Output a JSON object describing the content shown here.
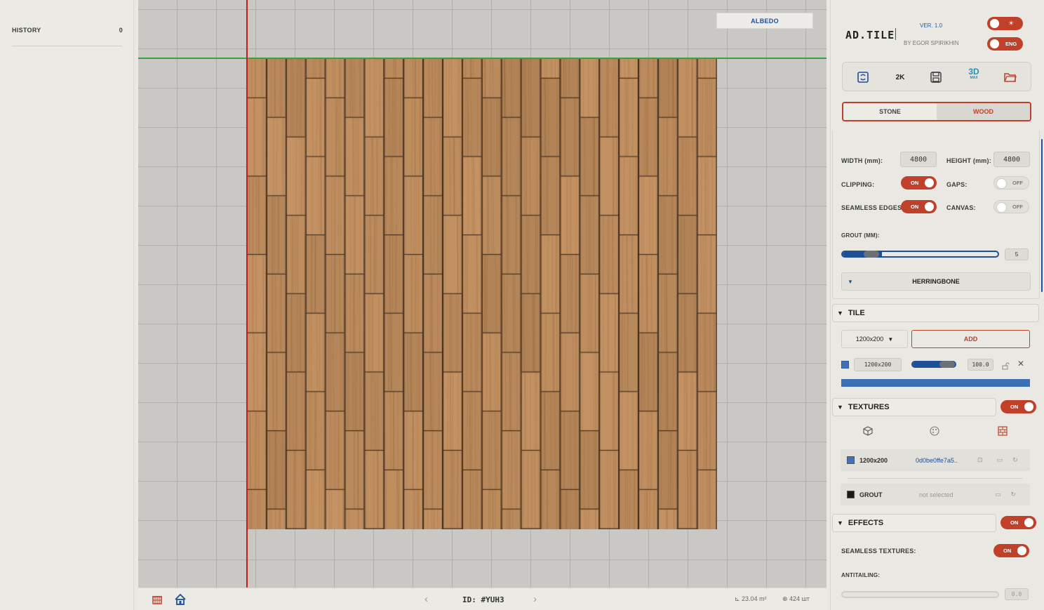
{
  "history": {
    "label": "HISTORY",
    "count": "0"
  },
  "viewport": {
    "channel_badge": "ALBEDO"
  },
  "bottom_bar": {
    "id_label": "ID: #YUH3",
    "area": "23.04 m²",
    "count": "424 шт"
  },
  "app": {
    "title": "AD.TILE",
    "version": "VER. 1.0",
    "author": "BY EGOR SPIRIKHIN",
    "lang": "ENG",
    "theme_icon": "☀"
  },
  "toolbar": {
    "resolution": "2K",
    "three_d": "3D",
    "three_d_sub": "MAX"
  },
  "material_tabs": {
    "stone": "STONE",
    "wood": "WOOD",
    "active": "wood"
  },
  "geometry": {
    "width_label": "WIDTH (mm):",
    "width_value": "4800",
    "height_label": "HEIGHT (mm):",
    "height_value": "4800",
    "clipping_label": "CLIPPING:",
    "clipping_state": "ON",
    "gaps_label": "GAPS:",
    "gaps_state": "OFF",
    "seamless_edges_label": "SEAMLESS EDGES:",
    "seamless_edges_state": "ON",
    "canvas_label": "CANVAS:",
    "canvas_state": "OFF",
    "grout_label": "GROUT (MM):",
    "grout_value": "5",
    "grout_level": 0.25,
    "pattern": "HERRINGBONE"
  },
  "tile": {
    "header": "TILE",
    "size_select": "1200x200",
    "add_label": "ADD",
    "row_size": "1200x200",
    "row_value": "100.0",
    "row_level": 1.0,
    "swatch_color": "#3f72b6"
  },
  "textures": {
    "header": "TEXTURES",
    "state": "ON",
    "rows": [
      {
        "name": "1200x200",
        "file": "0d0be0ffe7a5..",
        "swatch": "#3f72b6"
      },
      {
        "name": "GROUT",
        "file": "not selected",
        "swatch": "#1a1a1a"
      }
    ]
  },
  "effects": {
    "header": "EFFECTS",
    "state": "ON",
    "seamless_label": "SEAMLESS TEXTURES:",
    "seamless_state": "ON",
    "antialiasing_label": "ANTITAILING:",
    "antialiasing_value": "0.0"
  },
  "colors": {
    "accent": "#c0402a",
    "blue": "#1f4f95",
    "wood_base": "#b5875a",
    "grid_bg": "#c9c8c4"
  }
}
